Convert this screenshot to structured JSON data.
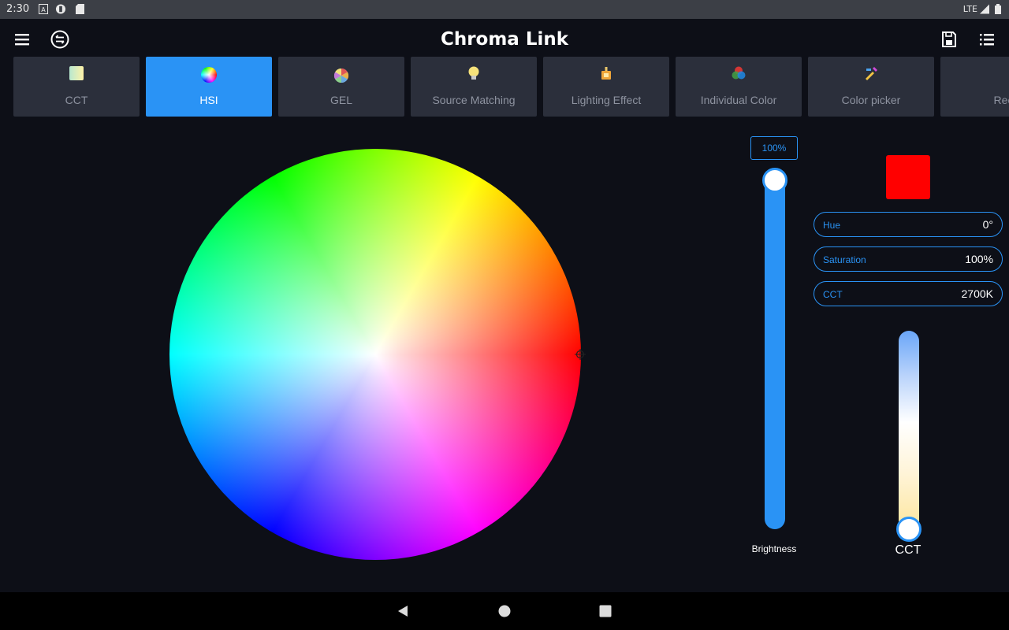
{
  "status_bar": {
    "time": "2:30",
    "network": "LTE"
  },
  "app_bar": {
    "title": "Chroma Link"
  },
  "tabs": [
    {
      "label": "CCT",
      "icon": "cct-swatch-icon",
      "active": false
    },
    {
      "label": "HSI",
      "icon": "color-wheel-icon",
      "active": true
    },
    {
      "label": "GEL",
      "icon": "gel-fan-icon",
      "active": false
    },
    {
      "label": "Source Matching",
      "icon": "lightbulb-icon",
      "active": false
    },
    {
      "label": "Lighting Effect",
      "icon": "lamp-icon",
      "active": false
    },
    {
      "label": "Individual Color",
      "icon": "rgb-circles-icon",
      "active": false
    },
    {
      "label": "Color picker",
      "icon": "color-picker-icon",
      "active": false
    },
    {
      "label": "Rec",
      "icon": "",
      "active": false
    }
  ],
  "brightness": {
    "value": "100%",
    "label": "Brightness",
    "level": 1.0
  },
  "color": {
    "swatch": "#ff0000"
  },
  "fields": {
    "hue": {
      "label": "Hue",
      "value": "0°"
    },
    "saturation": {
      "label": "Saturation",
      "value": "100%"
    },
    "cct": {
      "label": "CCT",
      "value": "2700K"
    }
  },
  "cct_slider": {
    "label": "CCT",
    "level": 0.0
  },
  "colors": {
    "accent": "#2a93f5",
    "background": "#0d0f17",
    "tab": "#2b2f3b"
  }
}
